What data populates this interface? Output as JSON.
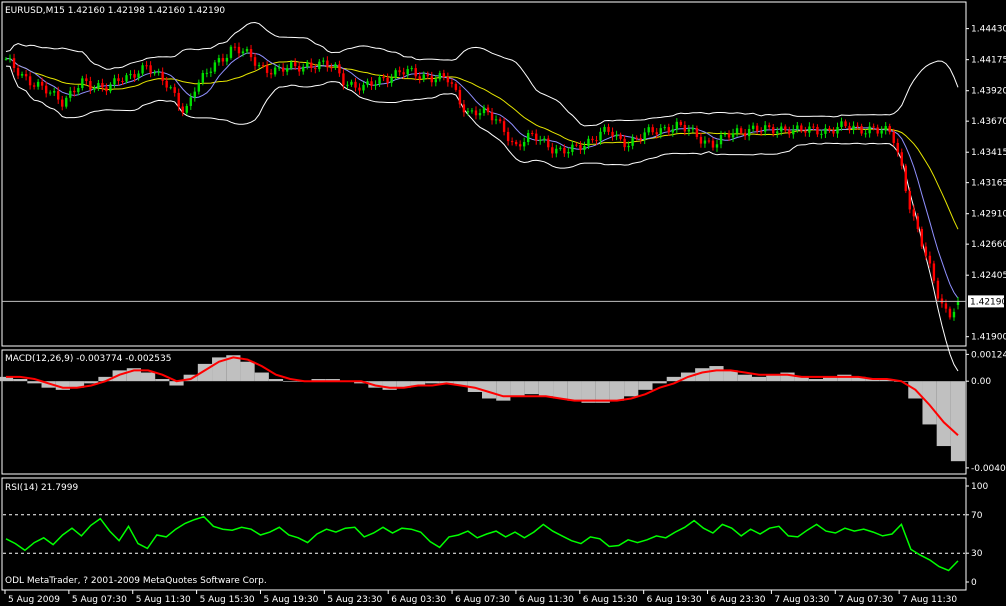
{
  "colors": {
    "background": "#000000",
    "frame": "#ffffff",
    "bull_candle": "#00e000",
    "bear_candle": "#ff0000",
    "bands": "#ffffff",
    "ma_fast": "#9090ff",
    "ma_slow": "#e6e600",
    "macd_hist": "#c0c0c0",
    "macd_signal": "#ff0000",
    "rsi_line": "#00ff00",
    "level_dashes": "#ffffff"
  },
  "price_panel": {
    "title": "EURUSD,M15  1.42160 1.42198 1.42160 1.42190",
    "current_price_label": "1.42190"
  },
  "macd_panel": {
    "title": "MACD(12,26,9) -0.003774 -0.002535"
  },
  "rsi_panel": {
    "title": "RSI(14) 21.7999",
    "copyright": "ODL MetaTrader, ? 2001-2009 MetaQuotes Software Corp."
  },
  "time_axis": [
    "5 Aug 2009",
    "5 Aug 07:30",
    "5 Aug 11:30",
    "5 Aug 15:30",
    "5 Aug 19:30",
    "5 Aug 23:30",
    "6 Aug 03:30",
    "6 Aug 07:30",
    "6 Aug 11:30",
    "6 Aug 15:30",
    "6 Aug 19:30",
    "6 Aug 23:30",
    "7 Aug 03:30",
    "7 Aug 07:30",
    "7 Aug 11:30"
  ],
  "chart_data": [
    {
      "type": "candlestick",
      "title": "EURUSD,M15",
      "ohlc_last": {
        "open": 1.4216,
        "high": 1.42198,
        "low": 1.4216,
        "close": 1.4219
      },
      "y_ticks": [
        "1.44430",
        "1.44175",
        "1.43920",
        "1.43670",
        "1.43415",
        "1.43165",
        "1.42910",
        "1.42660",
        "1.42405",
        "1.41900"
      ],
      "ylim": [
        1.4184,
        1.4455
      ],
      "x_ticks": [
        "5 Aug 2009",
        "5 Aug 07:30",
        "5 Aug 11:30",
        "5 Aug 15:30",
        "5 Aug 19:30",
        "5 Aug 23:30",
        "6 Aug 03:30",
        "6 Aug 07:30",
        "6 Aug 11:30",
        "6 Aug 15:30",
        "6 Aug 19:30",
        "6 Aug 23:30",
        "7 Aug 03:30",
        "7 Aug 07:30",
        "7 Aug 11:30"
      ],
      "current_price": 1.4219,
      "close_path": [
        1.4416,
        1.441,
        1.4404,
        1.4398,
        1.4392,
        1.4388,
        1.4384,
        1.4392,
        1.4398,
        1.4394,
        1.4396,
        1.4398,
        1.4401,
        1.44,
        1.4408,
        1.4415,
        1.4405,
        1.4396,
        1.4386,
        1.4375,
        1.4395,
        1.4402,
        1.4412,
        1.442,
        1.4428,
        1.4424,
        1.4418,
        1.4412,
        1.441,
        1.4408,
        1.441,
        1.4412,
        1.4414,
        1.4413,
        1.4412,
        1.441,
        1.44,
        1.4396,
        1.4393,
        1.4398,
        1.4403,
        1.4405,
        1.4407,
        1.4406,
        1.4405,
        1.4404,
        1.4402,
        1.44,
        1.4385,
        1.4375,
        1.4375,
        1.4372,
        1.4368,
        1.436,
        1.4345,
        1.435,
        1.4355,
        1.4352,
        1.4345,
        1.434,
        1.4343,
        1.4348,
        1.4352,
        1.4356,
        1.4358,
        1.4352,
        1.435,
        1.4353,
        1.4356,
        1.4359,
        1.4362,
        1.4364,
        1.436,
        1.4356,
        1.4352,
        1.4349,
        1.4352,
        1.4356,
        1.4359,
        1.4362,
        1.436,
        1.4358,
        1.436,
        1.4362,
        1.436,
        1.4358,
        1.4359,
        1.436,
        1.4362,
        1.4362,
        1.436,
        1.4361,
        1.4362,
        1.4358,
        1.4356,
        1.433,
        1.4295,
        1.427,
        1.4245,
        1.4222,
        1.4208,
        1.4219
      ]
    },
    {
      "type": "bar",
      "title": "MACD(12,26,9)",
      "main_value": -0.003774,
      "signal_value": -0.002535,
      "y_ticks": [
        "0.00124",
        "0.00",
        "-0.00401"
      ],
      "ylim": [
        -0.0042,
        0.00135
      ],
      "series": [
        {
          "name": "MACD",
          "values": [
            0.0002,
            0.0001,
            -0.0001,
            -0.0003,
            -0.0004,
            -0.0003,
            -0.0001,
            0.0002,
            0.0005,
            0.0006,
            0.0004,
            0.0001,
            -0.0002,
            0.0003,
            0.0008,
            0.0011,
            0.0012,
            0.0009,
            0.0004,
            0.0001,
            0.0,
            0.0,
            0.0001,
            0.0001,
            0.0,
            -0.0001,
            -0.0003,
            -0.0004,
            -0.0003,
            -0.0002,
            -0.0001,
            -0.0001,
            -0.0002,
            -0.0005,
            -0.0008,
            -0.0009,
            -0.0007,
            -0.0006,
            -0.0007,
            -0.0008,
            -0.0009,
            -0.001,
            -0.001,
            -0.0009,
            -0.0007,
            -0.0004,
            -0.0001,
            0.0002,
            0.0004,
            0.0006,
            0.0007,
            0.0005,
            0.0003,
            0.0002,
            0.0003,
            0.0004,
            0.0002,
            0.0001,
            0.0002,
            0.0003,
            0.0002,
            0.0001,
            0.0001,
            0.0,
            -0.0008,
            -0.002,
            -0.003,
            -0.0037
          ]
        },
        {
          "name": "Signal",
          "values": [
            0.0002,
            0.0002,
            0.0001,
            -0.0001,
            -0.0003,
            -0.0003,
            -0.0002,
            0.0,
            0.0003,
            0.0005,
            0.0005,
            0.0003,
            0.0,
            0.0001,
            0.0005,
            0.0009,
            0.0011,
            0.001,
            0.0007,
            0.0003,
            0.0001,
            0.0,
            0.0,
            0.0,
            0.0,
            0.0,
            -0.0002,
            -0.0003,
            -0.0003,
            -0.0002,
            -0.0002,
            -0.0001,
            -0.0002,
            -0.0003,
            -0.0005,
            -0.0007,
            -0.0007,
            -0.0007,
            -0.0007,
            -0.0008,
            -0.0009,
            -0.0009,
            -0.0009,
            -0.0009,
            -0.0008,
            -0.0006,
            -0.0003,
            -0.0001,
            0.0002,
            0.0004,
            0.0005,
            0.0005,
            0.0004,
            0.0003,
            0.0003,
            0.0003,
            0.0002,
            0.0002,
            0.0002,
            0.0002,
            0.0002,
            0.0001,
            0.0001,
            0.0,
            -0.0004,
            -0.0011,
            -0.0019,
            -0.0025
          ]
        }
      ]
    },
    {
      "type": "line",
      "title": "RSI(14)",
      "current_value": 21.7999,
      "y_ticks": [
        "100",
        "70",
        "30",
        "0"
      ],
      "levels": [
        70,
        30
      ],
      "ylim": [
        0,
        100
      ],
      "series": [
        {
          "name": "RSI(14)",
          "values": [
            45,
            40,
            33,
            41,
            46,
            39,
            49,
            56,
            48,
            59,
            66,
            53,
            43,
            58,
            40,
            35,
            49,
            47,
            55,
            61,
            65,
            68,
            58,
            55,
            54,
            57,
            55,
            49,
            52,
            57,
            49,
            46,
            41,
            50,
            55,
            52,
            56,
            57,
            47,
            51,
            57,
            51,
            56,
            55,
            52,
            42,
            36,
            47,
            49,
            53,
            46,
            50,
            53,
            47,
            52,
            46,
            52,
            60,
            53,
            48,
            43,
            40,
            47,
            45,
            37,
            38,
            44,
            41,
            44,
            48,
            46,
            52,
            57,
            64,
            56,
            51,
            60,
            56,
            48,
            55,
            50,
            56,
            58,
            48,
            47,
            54,
            60,
            53,
            51,
            56,
            53,
            55,
            52,
            48,
            50,
            60,
            34,
            28,
            23,
            16,
            12,
            22
          ]
        }
      ]
    }
  ]
}
